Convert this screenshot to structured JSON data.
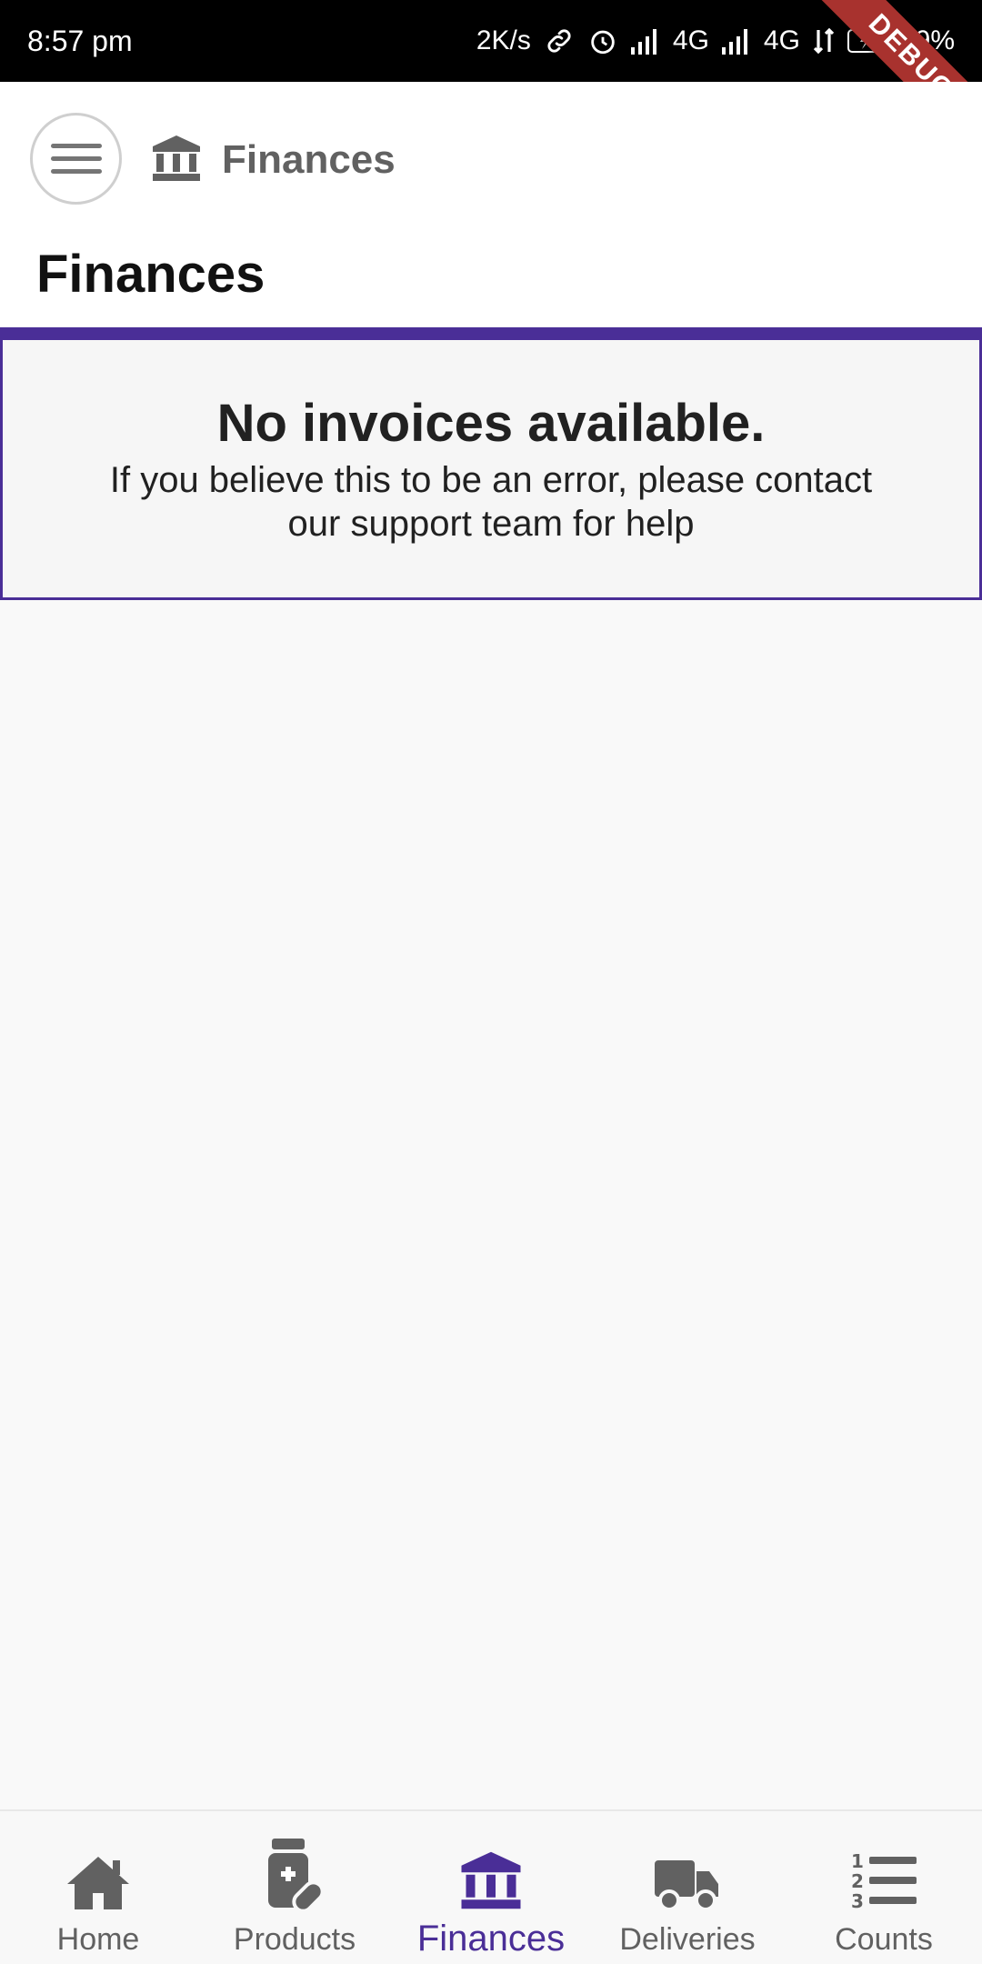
{
  "status_bar": {
    "time": "8:57 pm",
    "net_speed": "2K/s",
    "network1": "4G",
    "network2": "4G",
    "battery": "29%",
    "debug_label": "DEBUG"
  },
  "header": {
    "brand_label": "Finances",
    "page_title": "Finances"
  },
  "empty_state": {
    "title": "No invoices available.",
    "message": "If you believe this to be an error, please contact our support team for help"
  },
  "bottom_nav": {
    "items": [
      {
        "label": "Home",
        "icon": "home-icon"
      },
      {
        "label": "Products",
        "icon": "medicine-bottle-icon"
      },
      {
        "label": "Finances",
        "icon": "bank-icon"
      },
      {
        "label": "Deliveries",
        "icon": "truck-icon"
      },
      {
        "label": "Counts",
        "icon": "numbered-list-icon"
      }
    ],
    "active_index": 2
  },
  "colors": {
    "accent": "#4a2e97",
    "icon_gray": "#616161",
    "status_bar_bg": "#000000",
    "debug_ribbon": "#a8322e"
  }
}
